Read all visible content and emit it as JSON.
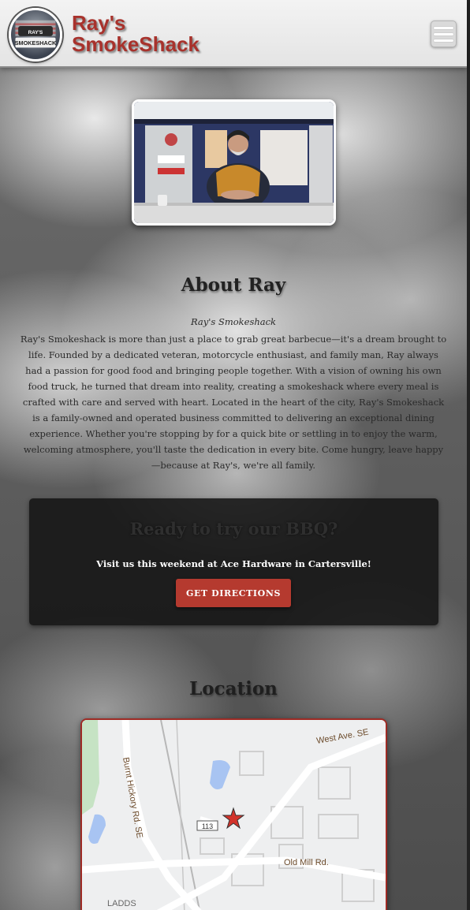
{
  "header": {
    "brand_line1": "Ray's",
    "brand_line2": "SmokeShack",
    "logo_text": "RAY'S SMOKESHACK",
    "menu_icon": "hamburger-icon"
  },
  "about": {
    "title": "About Ray",
    "subtitle": "Ray's Smokeshack",
    "body": "Ray's Smokeshack is more than just a place to grab great barbecue—it's a dream brought to life. Founded by a dedicated veteran, motorcycle enthusiast, and family man, Ray always had a passion for good food and bringing people together. With a vision of owning his own food truck, he turned that dream into reality, creating a smokeshack where every meal is crafted with care and served with heart. Located in the heart of the city, Ray's Smokeshack is a family-owned and operated business committed to delivering an exceptional dining experience. Whether you're stopping by for a quick bite or settling in to enjoy the warm, welcoming atmosphere, you'll taste the dedication in every bite. Come hungry, leave happy—because at Ray's, we're all family."
  },
  "cta": {
    "title": "Ready to try our BBQ?",
    "text": "Visit us this weekend at Ace Hardware in Cartersville!",
    "button": "GET DIRECTIONS"
  },
  "location": {
    "title": "Location",
    "map_labels": {
      "west_ave": "West Ave. SE",
      "burnt_hickory": "Burnt Hickory Rd. SE",
      "old_mill": "Old Mill Rd.",
      "route": "113",
      "ladds": "LADDS"
    },
    "marker_icon": "star-marker-icon"
  },
  "colors": {
    "brand_red": "#a8322c",
    "button_red": "#b53a2f",
    "header_bg": "#f3f3f3"
  }
}
